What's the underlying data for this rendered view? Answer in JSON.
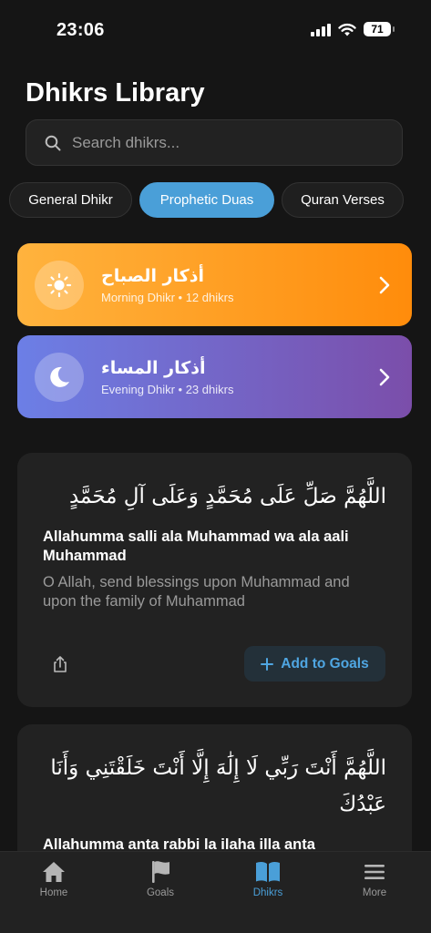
{
  "status_bar": {
    "time": "23:06",
    "battery": "71"
  },
  "page_title": "Dhikrs Library",
  "search": {
    "placeholder": "Search dhikrs..."
  },
  "tabs": [
    {
      "label": "General Dhikr",
      "active": false
    },
    {
      "label": "Prophetic Duas",
      "active": true
    },
    {
      "label": "Quran Verses",
      "active": false
    }
  ],
  "collections": [
    {
      "title_ar": "أذكار الصباح",
      "subtitle": "Morning Dhikr • 12 dhikrs",
      "icon": "sun-icon",
      "colors": [
        "#ffb33e",
        "#ff8c0b"
      ]
    },
    {
      "title_ar": "أذكار المساء",
      "subtitle": "Evening Dhikr • 23 dhikrs",
      "icon": "moon-icon",
      "colors": [
        "#6c7fe6",
        "#7b4eaa"
      ]
    }
  ],
  "duas": [
    {
      "arabic": "اللَّهُمَّ صَلِّ عَلَى مُحَمَّدٍ وَعَلَى آلِ مُحَمَّدٍ",
      "transliteration": "Allahumma salli ala Muhammad wa ala aali Muhammad",
      "translation": "O Allah, send blessings upon Muhammad and upon the family of Muhammad",
      "add_label": "Add to Goals"
    },
    {
      "arabic": "اللَّهُمَّ أَنْتَ رَبِّي لَا إِلَٰهَ إِلَّا أَنْتَ خَلَقْتَنِي وَأَنَا عَبْدُكَ",
      "transliteration": "Allahumma anta rabbi la ilaha illa anta"
    }
  ],
  "bottom_nav": [
    {
      "label": "Home",
      "icon": "home-icon",
      "active": false
    },
    {
      "label": "Goals",
      "icon": "flag-icon",
      "active": false
    },
    {
      "label": "Dhikrs",
      "icon": "book-icon",
      "active": true
    },
    {
      "label": "More",
      "icon": "menu-icon",
      "active": false
    }
  ],
  "colors": {
    "accent": "#4a9fd8",
    "background": "#151515",
    "card": "#222222"
  }
}
